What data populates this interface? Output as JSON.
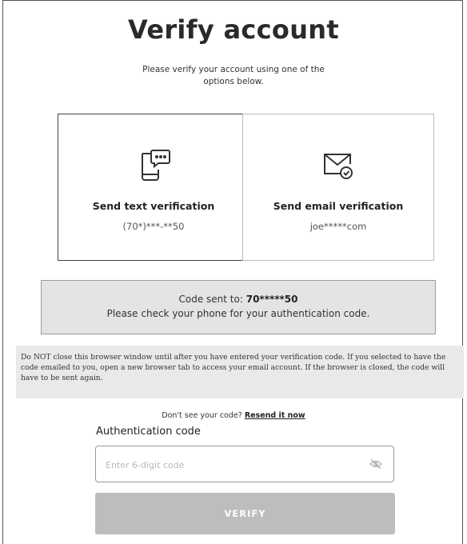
{
  "header": {
    "title": "Verify account",
    "subtitle": "Please verify your account using one of the options below."
  },
  "options": {
    "text": {
      "label": "Send text verification",
      "value": "(70*)***-**50",
      "icon": "phone-chat-icon"
    },
    "email": {
      "label": "Send email verification",
      "value": "joe*****com",
      "icon": "envelope-check-icon"
    }
  },
  "status": {
    "sent_prefix": "Code sent to:",
    "sent_to": "70*****50",
    "instruction": "Please check your phone for your authentication code."
  },
  "warning": "Do NOT close this browser window until after you have entered your verification code. If you selected to have the code emailed to you, open a new browser tab to access your email account. If the browser is closed, the code will have to be sent again.",
  "resend": {
    "prompt": "Don't see your code?",
    "link": "Resend it now"
  },
  "form": {
    "label": "Authentication code",
    "placeholder": "Enter 6-digit code",
    "value": "",
    "visibility_icon": "eye-hidden-icon",
    "submit_label": "VERIFY"
  }
}
